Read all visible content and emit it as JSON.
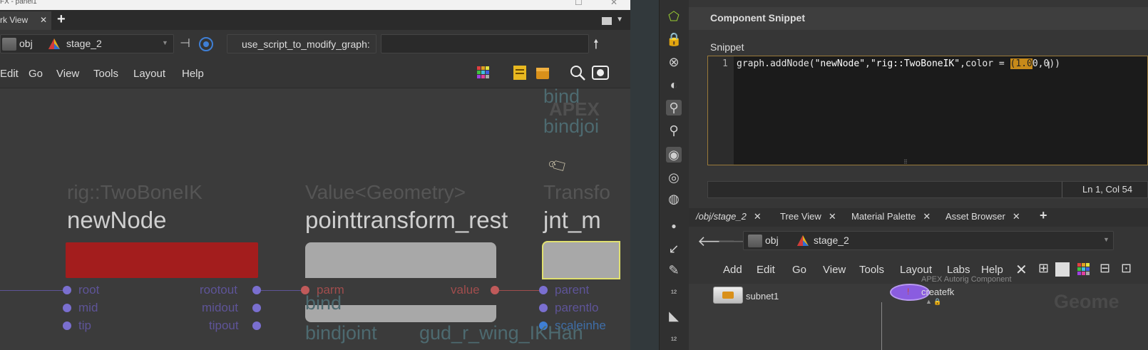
{
  "left_window": {
    "title_partial": "FX - panel1",
    "tab_label": "rk View",
    "path": {
      "context": "obj",
      "node": "stage_2"
    },
    "script_field_label": "use_script_to_modify_graph:",
    "script_field_value": "",
    "menu": [
      "Edit",
      "Go",
      "View",
      "Tools",
      "Layout",
      "Help"
    ]
  },
  "graph": {
    "ghost_top_1": "bind",
    "ghost_top_2": "APEX",
    "ghost_top_3": "bindjoi",
    "node1": {
      "type": "rig::TwoBoneIK",
      "name": "newNode",
      "color": "#a31d1d",
      "inputs": [
        "root",
        "mid",
        "tip"
      ],
      "outputs": [
        "rootout",
        "midout",
        "tipout"
      ]
    },
    "node2": {
      "type": "Value<Geometry>",
      "name": "pointtransform_rest",
      "color": "#9a9a9a",
      "input": "parm",
      "output": "value",
      "ghost_1": "bind",
      "ghost_bottom": "bindjoint"
    },
    "node3": {
      "type_partial": "Transfo",
      "name_partial": "jnt_m",
      "inputs": [
        "parent",
        "parentlo",
        "scaleinhe"
      ],
      "ghost_bottom": "gud_r_wing_IKHan"
    }
  },
  "right_panel": {
    "title": "Component Snippet",
    "snippet_label": "Snippet",
    "code": {
      "line_number": "1",
      "before": "graph.addNode(",
      "arg1": "\"newNode\"",
      "comma": ",",
      "arg2": "\"rig::TwoBoneIK\"",
      "middle": ",color = ",
      "selected": "(1.0",
      "after": "0,0))"
    },
    "cursor_position": "Ln 1, Col 54",
    "tabs": [
      "/obj/stage_2",
      "Tree View",
      "Material Palette",
      "Asset Browser"
    ],
    "path": {
      "context": "obj",
      "node": "stage_2"
    },
    "menu": [
      "Add",
      "Edit",
      "Go",
      "View",
      "Tools",
      "Layout",
      "Labs",
      "Help"
    ],
    "nodes": [
      {
        "name": "subnet1"
      },
      {
        "header": "APEX Autorig Component",
        "name": "createfk"
      }
    ],
    "watermark": "Geome"
  }
}
